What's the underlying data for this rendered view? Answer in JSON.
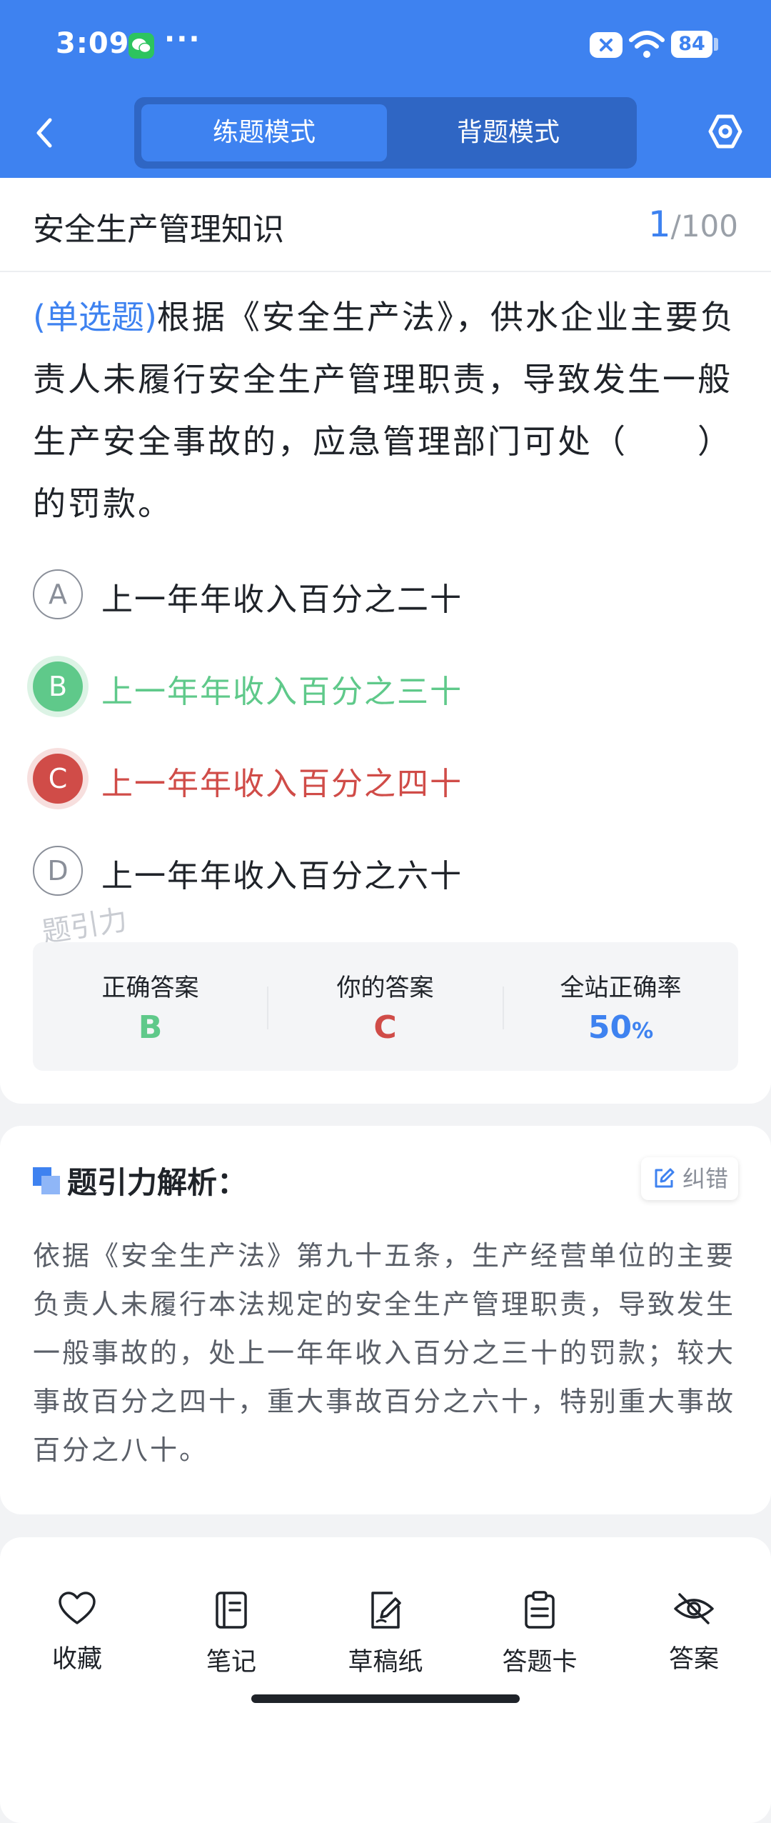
{
  "status_bar": {
    "time": "3:09",
    "dots": "···",
    "battery": "84"
  },
  "header": {
    "tabs": [
      {
        "label": "练题模式",
        "active": true
      },
      {
        "label": "背题模式",
        "active": false
      }
    ]
  },
  "question": {
    "subject": "安全生产管理知识",
    "current": "1",
    "total": "/100",
    "type": "(单选题)",
    "text": "根据《安全生产法》，供水企业主要负责人未履行安全生产管理职责，导致发生一般生产安全事故的，应急管理部门可处（　　）的罚款。",
    "options": [
      {
        "letter": "A",
        "text": "上一年年收入百分之二十",
        "state": "normal"
      },
      {
        "letter": "B",
        "text": "上一年年收入百分之三十",
        "state": "correct"
      },
      {
        "letter": "C",
        "text": "上一年年收入百分之四十",
        "state": "wrong"
      },
      {
        "letter": "D",
        "text": "上一年年收入百分之六十",
        "state": "normal"
      }
    ],
    "watermark": "题引力"
  },
  "answer_summary": {
    "correct_label": "正确答案",
    "correct_value": "B",
    "yours_label": "你的答案",
    "yours_value": "C",
    "rate_label": "全站正确率",
    "rate_value": "50",
    "rate_unit": "%"
  },
  "analysis": {
    "title": "题引力解析：",
    "report_label": "纠错",
    "text": "依据《安全生产法》第九十五条，生产经营单位的主要负责人未履行本法规定的安全生产管理职责，导致发生一般事故的，处上一年年收入百分之三十的罚款；较大事故百分之四十，重大事故百分之六十，特别重大事故百分之八十。"
  },
  "bottom_bar": {
    "favorite": "收藏",
    "notes": "笔记",
    "draft": "草稿纸",
    "answer_card": "答题卡",
    "answer": "答案"
  },
  "colors": {
    "primary": "#3e82f0",
    "correct": "#5fc98a",
    "wrong": "#d04c48"
  }
}
